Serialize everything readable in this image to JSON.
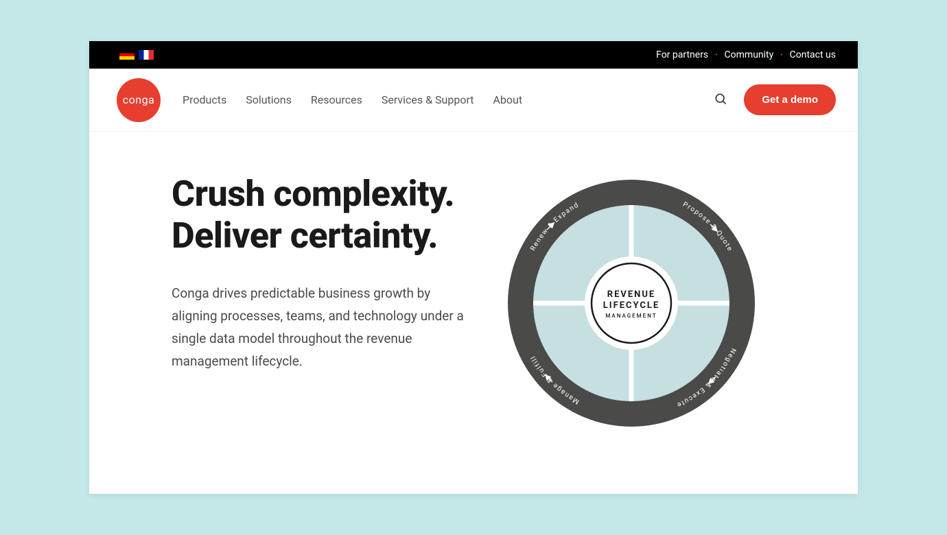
{
  "topbar": {
    "links": [
      "For partners",
      "Community",
      "Contact us"
    ]
  },
  "logo": {
    "text": "conga"
  },
  "nav": {
    "items": [
      "Products",
      "Solutions",
      "Resources",
      "Services & Support",
      "About"
    ]
  },
  "cta": {
    "label": "Get a demo"
  },
  "hero": {
    "heading": "Crush complexity. Deliver certainty.",
    "subtext": "Conga drives predictable business growth by aligning processes, teams, and technology under a single data model throughout the revenue management lifecycle."
  },
  "diagram": {
    "center_line1": "REVENUE",
    "center_line2": "LIFECYCLE",
    "center_line3": "MANAGEMENT",
    "segments": [
      "Propose & Quote",
      "Negotiate & Execute",
      "Manage & Fulfill",
      "Renew & Expand"
    ]
  }
}
